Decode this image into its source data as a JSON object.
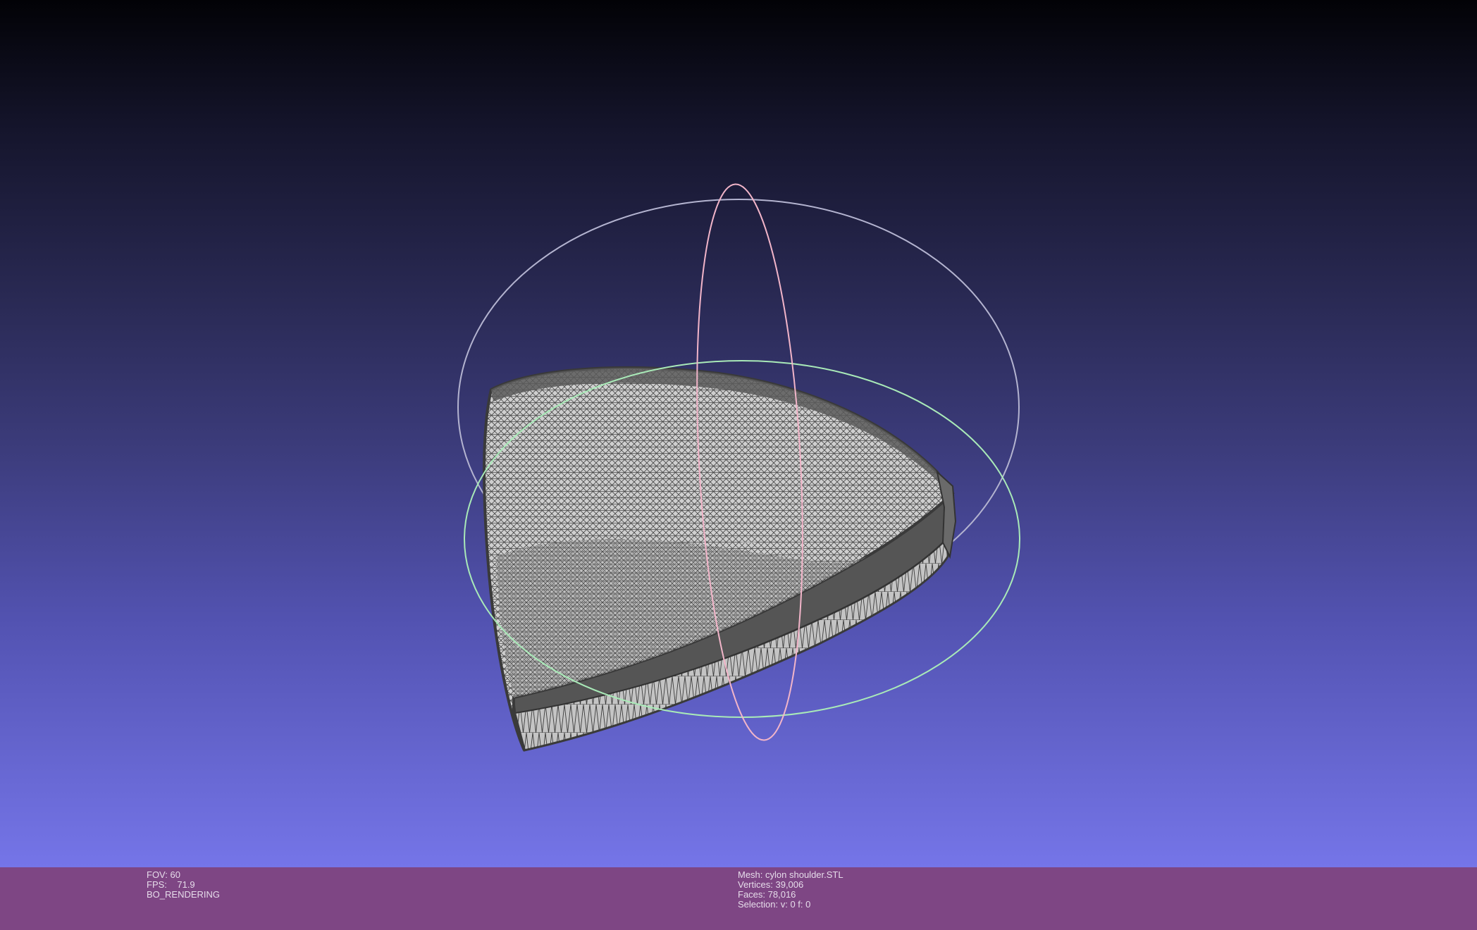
{
  "viewer": {
    "background_top": "#020206",
    "background_bottom": "#7575e8",
    "statusbar_color": "#7e4684"
  },
  "render_info": {
    "fov_label": "FOV:",
    "fov_value": "60",
    "fps_label": "FPS:",
    "fps_value": "71.9",
    "mode": "BO_RENDERING"
  },
  "mesh_info": {
    "mesh_label": "Mesh:",
    "mesh_value": "cylon shoulder.STL",
    "vertices_label": "Vertices:",
    "vertices_value": "39,006",
    "faces_label": "Faces:",
    "faces_value": "78,016",
    "selection_label": "Selection:",
    "selection_value": "v: 0 f: 0"
  },
  "trackball": {
    "ring_colors": [
      "#b9b9d6",
      "#f2b5c9",
      "#a9eab8"
    ]
  },
  "mesh_render": {
    "fill": "#c9c9c9",
    "wire": "#3d3d3d"
  }
}
